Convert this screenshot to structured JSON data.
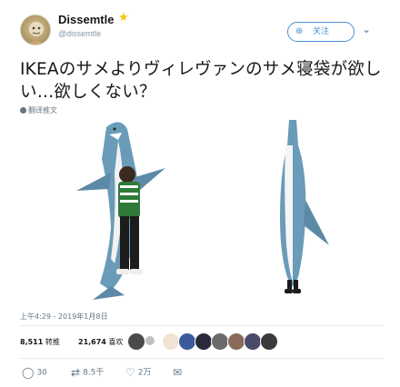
{
  "user": {
    "display_name": "Dissemtle",
    "handle": "@dissemtle"
  },
  "follow_button": {
    "label": "关注"
  },
  "tweet": {
    "text": "IKEAのサメよりヴィレヴァンのサメ寝袋が欲しい…欲しくない？",
    "translate_label": "翻译推文",
    "timestamp": "上午4:29 - 2019年1月8日"
  },
  "stats": {
    "retweets_count": "8,511",
    "retweets_label": "转推",
    "likes_count": "21,674",
    "likes_label": "喜欢"
  },
  "actions": {
    "reply_count": "30",
    "retweet_count": "8.5千",
    "like_count": "2万"
  },
  "colors": {
    "accent": "#4a90d9",
    "shark_blue": "#6a9bb8",
    "muted": "#657786"
  }
}
